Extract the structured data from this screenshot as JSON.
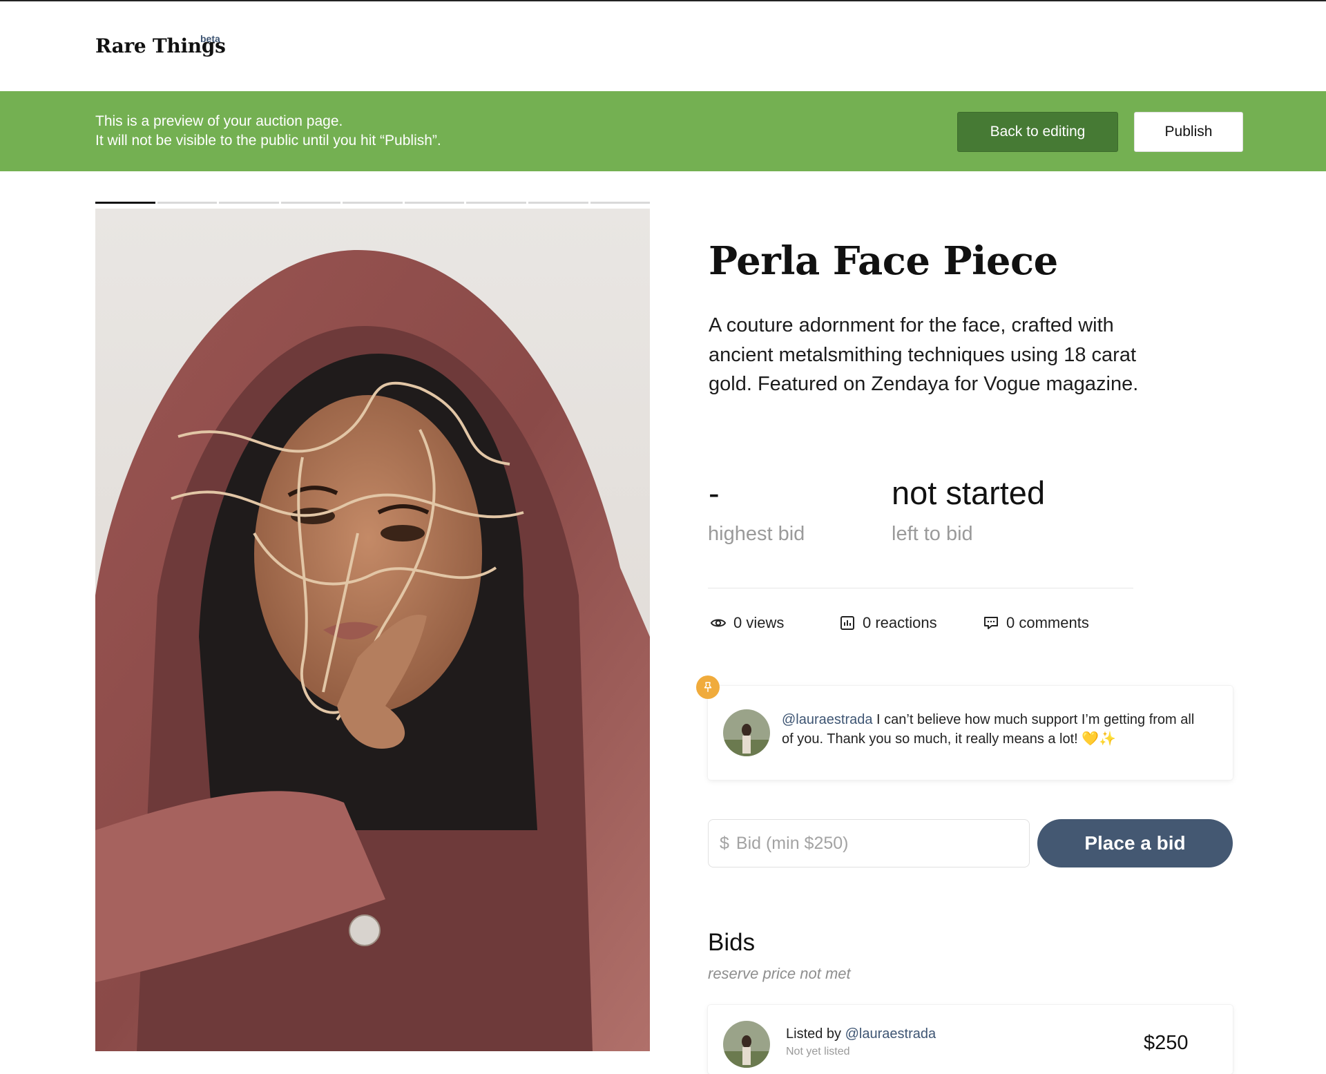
{
  "header": {
    "logo": "Rare Things",
    "logo_badge": "beta"
  },
  "banner": {
    "line1": "This is a preview of your auction page.",
    "line2": "It will not be visible to the public until you hit “Publish”.",
    "back_label": "Back to editing",
    "publish_label": "Publish",
    "color": "#74b052"
  },
  "gallery": {
    "image_count": 9,
    "active_index": 0
  },
  "item": {
    "title": "Perla Face Piece",
    "description": "A couture adornment for the face, crafted with ancient metalsmithing techniques using 18 carat gold. Featured on Zendaya for Vogue magazine."
  },
  "stats": {
    "highest_bid_value": "-",
    "highest_bid_label": "highest bid",
    "time_value": "not started",
    "time_label": "left to bid"
  },
  "meta": {
    "views": "0 views",
    "reactions": "0 reactions",
    "comments": "0 comments"
  },
  "pinned_comment": {
    "handle": "@lauraestrada",
    "text": " I can’t believe how much support I’m getting from all of you. Thank you so much, it really means a lot! 💛✨"
  },
  "bid_form": {
    "currency": "$",
    "placeholder": "Bid (min $250)",
    "button_label": "Place a bid",
    "button_color": "#445872"
  },
  "bids": {
    "title": "Bids",
    "subtitle": "reserve price not met",
    "entries": [
      {
        "prefix": "Listed by ",
        "handle": "@lauraestrada",
        "sub": "Not yet listed",
        "amount": "$250"
      }
    ]
  }
}
